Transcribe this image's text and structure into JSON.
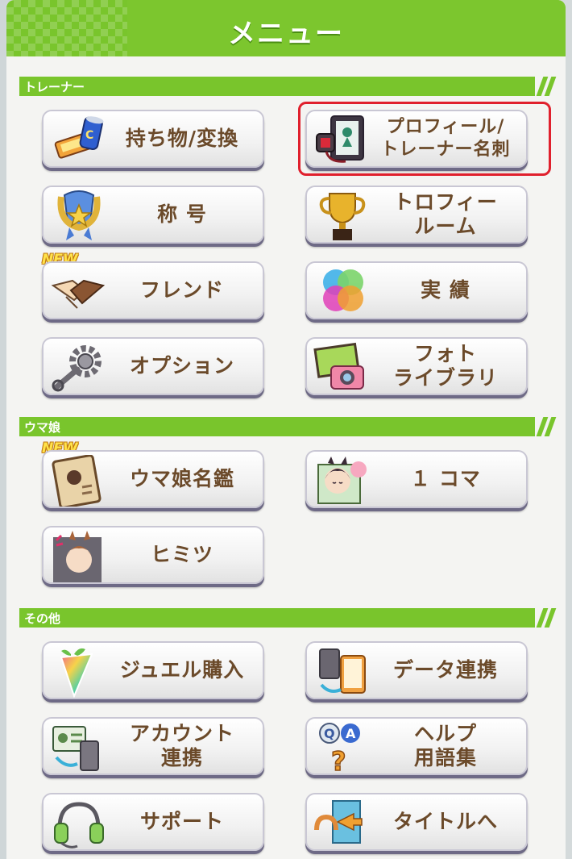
{
  "header": {
    "title": "メニュー"
  },
  "sections": {
    "trainer": "トレーナー",
    "uma": "ウマ娘",
    "other": "その他"
  },
  "buttons": {
    "items_convert": "持ち物/変換",
    "profile_l1": "プロフィール/",
    "profile_l2": "トレーナー名刺",
    "title_label": "称 号",
    "trophy_l1": "トロフィー",
    "trophy_l2": "ルーム",
    "friend": "フレンド",
    "achievement": "実 績",
    "option": "オプション",
    "photo_l1": "フォト",
    "photo_l2": "ライブラリ",
    "uma_dex": "ウマ娘名鑑",
    "one_koma": "１ コマ",
    "himitsu": "ヒミツ",
    "jewel": "ジュエル購入",
    "data_link": "データ連携",
    "account_l1": "アカウント",
    "account_l2": "連携",
    "help_l1": "ヘルプ",
    "help_l2": "用語集",
    "support": "サポート",
    "to_title": "タイトルへ"
  },
  "badges": {
    "new": "NEW"
  },
  "colors": {
    "accent_green": "#79c52c",
    "label_brown": "#6b4a2a",
    "highlight_red": "#e0202d"
  }
}
